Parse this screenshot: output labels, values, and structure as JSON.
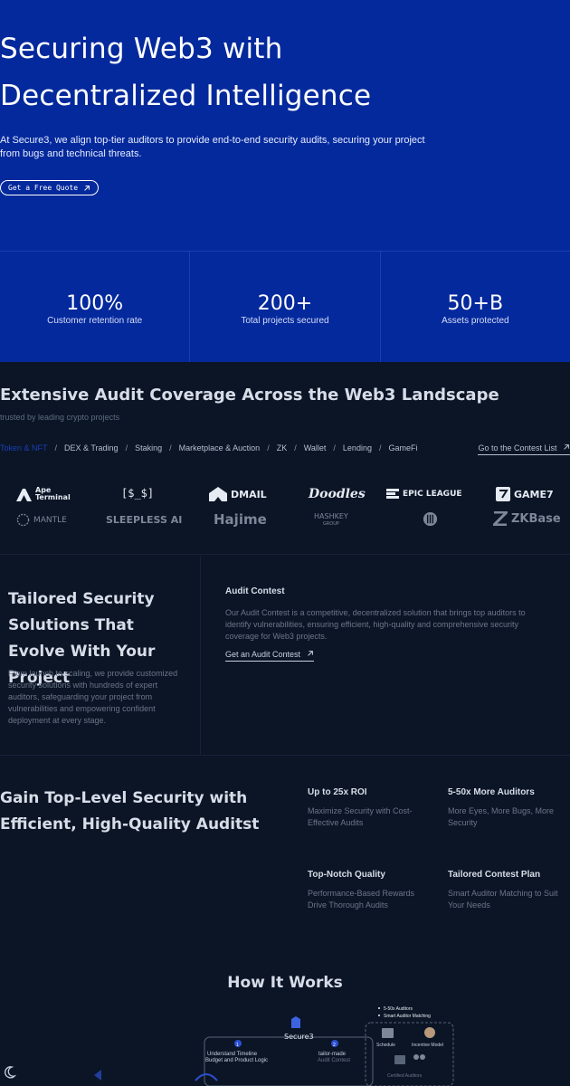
{
  "hero": {
    "title_line1": "Securing Web3 with",
    "title_line2": "Decentralized Intelligence",
    "subtitle": "At Secure3, we align top-tier auditors to provide end-to-end security audits, securing your project from bugs and technical threats.",
    "cta_label": "Get a Free Quote"
  },
  "stats": [
    {
      "value": "100%",
      "label": "Customer retention rate"
    },
    {
      "value": "200+",
      "label": "Total projects secured"
    },
    {
      "value": "50+B",
      "label": "Assets protected"
    }
  ],
  "coverage": {
    "title": "Extensive Audit Coverage Across the Web3 Landscape",
    "subtitle": "trusted by leading crypto projects",
    "tabs": [
      "Token & NFT",
      "DEX & Trading",
      "Staking",
      "Marketplace & Auction",
      "ZK",
      "Wallet",
      "Lending",
      "GameFi"
    ],
    "contest_link": "Go to the Contest List",
    "logos": {
      "ape_line1": "Ape",
      "ape_line2": "Terminal",
      "dollar": "[$_$]",
      "dmail": "DMAIL",
      "doodles": "Doodles",
      "epic": "EPIC LEAGUE",
      "game7": "GAME7",
      "mantle": "MANTLE",
      "sleepless": "SLEEPLESS AI",
      "hajime": "Hajime",
      "hashkey_line1": "HASHKEY",
      "hashkey_line2": "GROUP",
      "zkbase": "ZKBase"
    }
  },
  "tailored": {
    "title": "Tailored Security Solutions That Evolve With Your Project",
    "body": "From launch to scaling, we provide customized security solutions with hundreds of expert auditors, safeguarding your project from vulnerabilities and empowering confident deployment at every stage.",
    "audit_contest_title": "Audit Contest",
    "audit_contest_body": "Our Audit Contest is a competitive, decentralized solution that brings top auditors to identify vulnerabilities, ensuring efficient, high-quality and comprehensive security coverage for Web3 projects.",
    "audit_contest_link": "Get an Audit Contest"
  },
  "gain": {
    "title": "Gain Top-Level Security with Efficient, High-Quality Auditst",
    "features": [
      {
        "title": "Up to 25x ROI",
        "body": "Maximize Security with Cost-Effective Audits"
      },
      {
        "title": "5-50x More Auditors",
        "body": "More Eyes, More Bugs, More Security"
      },
      {
        "title": "Top-Notch Quality",
        "body": "Performance-Based Rewards Drive Thorough Audits"
      },
      {
        "title": "Tailored Contest Plan",
        "body": "Smart Auditor Matching to Suit Your Needs"
      }
    ]
  },
  "how": {
    "title": "How It Works",
    "brand": "Secure3",
    "step1_num": "1",
    "step1_line1": "Understand Timeline",
    "step1_line2": "Budget and Product Logic",
    "step2_num": "2",
    "step2_line1": "tailor-made",
    "step2_line2": "Audit Contest",
    "bullet1": "5-50x Auditors",
    "bullet2": "Smart Auditor Matching",
    "schedule": "Schedule",
    "incentive": "Incentive Model",
    "certified": "Certified Auditors"
  },
  "colors": {
    "hero_bg": "#04299c",
    "page_bg": "#0b1526",
    "accent": "#1b3fb8"
  }
}
